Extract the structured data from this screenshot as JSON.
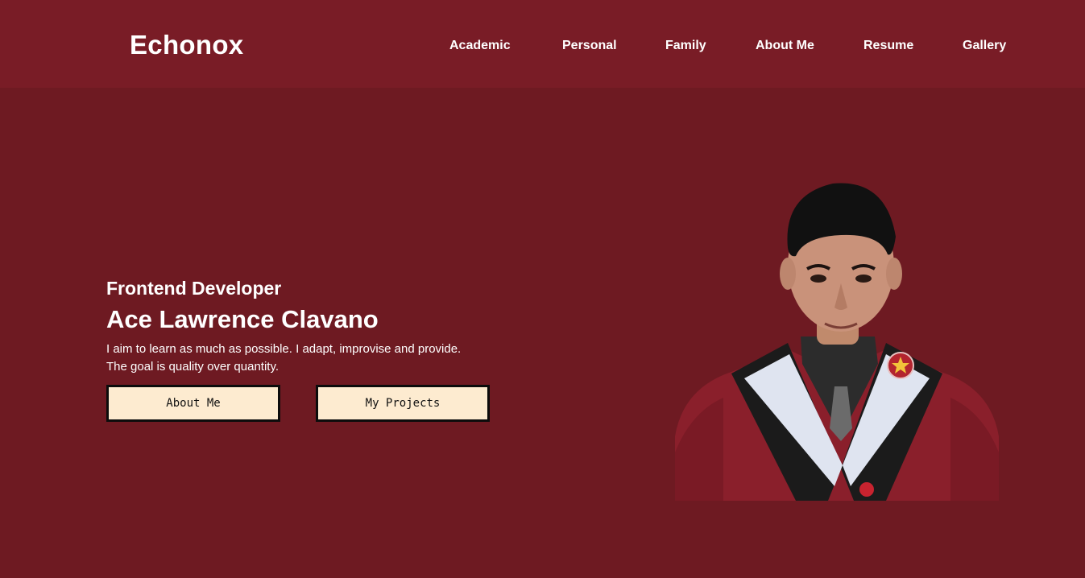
{
  "header": {
    "brand": "Echonox",
    "nav": [
      "Academic",
      "Personal",
      "Family",
      "About Me",
      "Resume",
      "Gallery"
    ]
  },
  "hero": {
    "role": "Frontend Developer",
    "name": "Ace Lawrence Clavano",
    "tagline_line1": "I aim to learn as much as possible. I adapt, improvise and provide.",
    "tagline_line2": "The goal is quality over quantity.",
    "about_button": "About Me",
    "projects_button": "My Projects"
  },
  "colors": {
    "background": "#6e1a22",
    "header": "#791c26",
    "button_fill": "#fdebd0",
    "text": "#ffffff"
  }
}
